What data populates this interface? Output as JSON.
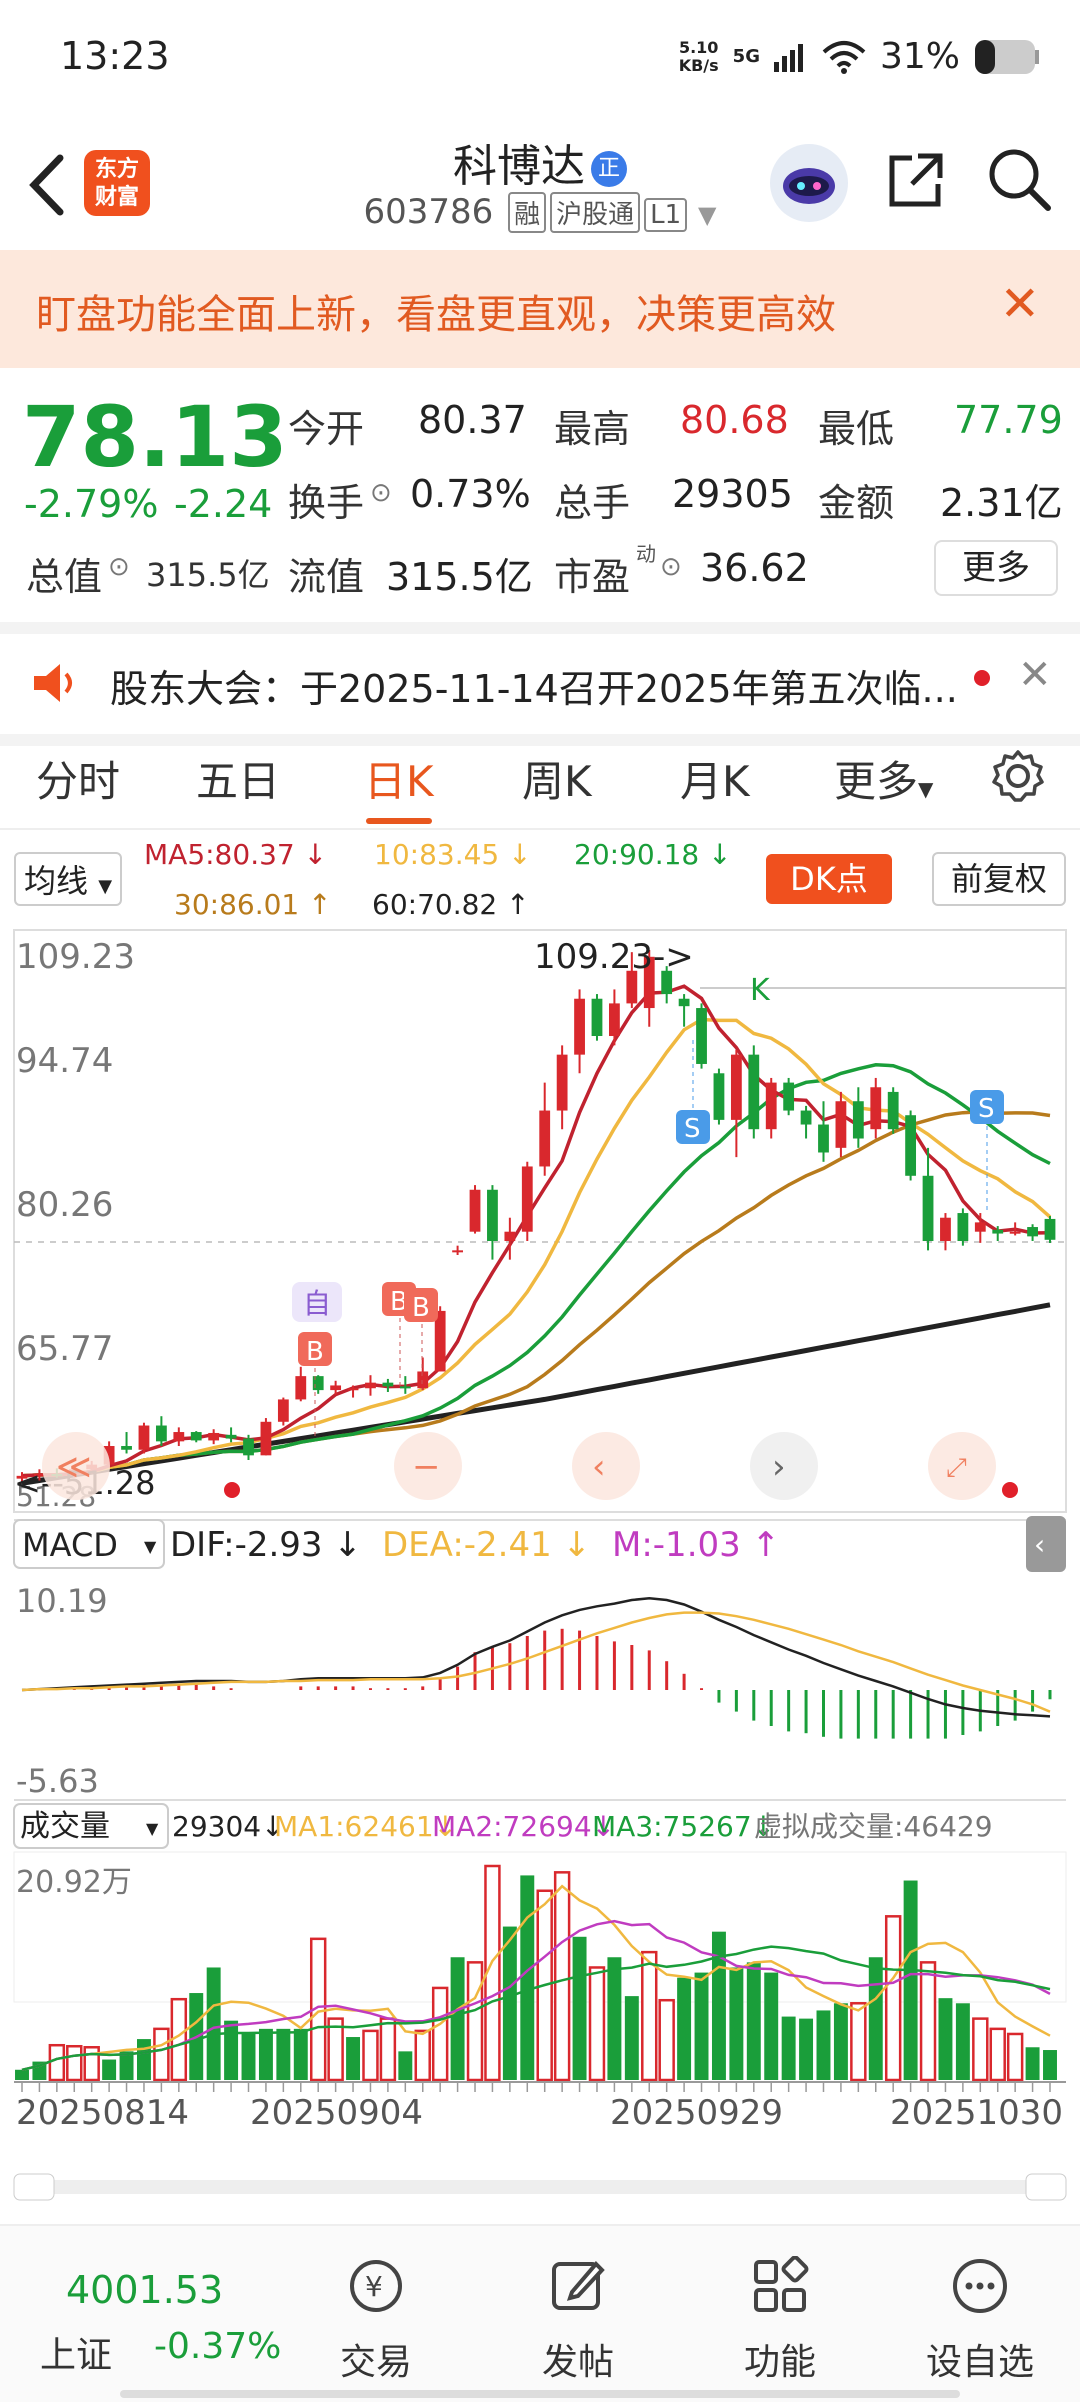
{
  "status_bar": {
    "time": "13:23",
    "net_speed": "5.10\nKB/s",
    "signal": "5G",
    "battery": "31%"
  },
  "header": {
    "title": "科博达",
    "badge": "正",
    "code": "603786",
    "tags": [
      "融",
      "沪股通",
      "L1"
    ],
    "logo_text": "东方财富"
  },
  "banner": {
    "text": "盯盘功能全面上新，看盘更直观，决策更高效",
    "close": "✕"
  },
  "quote": {
    "price": "78.13",
    "change_pct": "-2.79%",
    "change": "-2.24",
    "fields": {
      "open_label": "今开",
      "open": "80.37",
      "high_label": "最高",
      "high": "80.68",
      "low_label": "最低",
      "low": "77.79",
      "turnover_label": "换手",
      "turnover": "0.73%",
      "volume_label": "总手",
      "volume": "29305",
      "amount_label": "金额",
      "amount": "2.31亿",
      "mktcap_label": "总值",
      "mktcap": "315.5亿",
      "float_label": "流值",
      "float": "315.5亿",
      "pe_label": "市盈",
      "pe_sup": "动",
      "pe": "36.62"
    },
    "more": "更多"
  },
  "notice": {
    "text": "股东大会：于2025-11-14召开2025年第五次临..."
  },
  "tabs": [
    "分时",
    "五日",
    "日K",
    "周K",
    "月K",
    "更多"
  ],
  "active_tab": "日K",
  "ma_row": {
    "selector": "均线",
    "ma5": "MA5:80.37 ↓",
    "ma10": "10:83.45 ↓",
    "ma20": "20:90.18 ↓",
    "ma30": "30:86.01 ↑",
    "ma60": "60:70.82 ↑",
    "dk": "DK点",
    "adjust": "前复权"
  },
  "kline": {
    "y_labels": [
      "109.23",
      "94.74",
      "80.26",
      "65.77",
      "51.28"
    ],
    "peak_label": "109.23->",
    "low_label": "<--51.28",
    "markers": [
      "自",
      "B",
      "B",
      "B",
      "S",
      "S",
      "K"
    ],
    "colors": {
      "up": "#d9282d",
      "down": "#1a9e3a",
      "ma5": "#c0222f",
      "ma10": "#f0b840",
      "ma20": "#1a9e3a",
      "ma30": "#b87b1c",
      "ma60": "#222222"
    }
  },
  "macd": {
    "selector": "MACD",
    "dif": "DIF:-2.93 ↓",
    "dea": "DEA:-2.41 ↓",
    "m": "M:-1.03 ↑",
    "y_top": "10.19",
    "y_bottom": "-5.63"
  },
  "volume": {
    "selector": "成交量",
    "vol": "29304↓",
    "ma1": "MA1:62461↓",
    "ma2": "MA2:72694↓",
    "ma3": "MA3:75267↓",
    "virtual": "虚拟成交量:46429",
    "y_top": "20.92万"
  },
  "x_dates": [
    "20250814",
    "20250904",
    "20250929",
    "20251030"
  ],
  "bottom_nav": {
    "index_value": "4001.53",
    "index_name": "上证",
    "index_change": "-0.37%",
    "items": [
      "交易",
      "发帖",
      "功能",
      "设自选"
    ]
  },
  "chart_data": {
    "type": "candlestick",
    "title": "",
    "x_range": [
      "20250814",
      "20251030"
    ],
    "y_range": [
      51.28,
      109.23
    ],
    "ohlc": [
      [
        52.5,
        53.2,
        52.0,
        52.8
      ],
      [
        52.8,
        53.5,
        52.3,
        53.0
      ],
      [
        53.0,
        53.6,
        52.6,
        52.9
      ],
      [
        53.0,
        53.8,
        52.6,
        53.5
      ],
      [
        53.5,
        54.4,
        53.0,
        54.0
      ],
      [
        54.0,
        56.5,
        53.8,
        56.0
      ],
      [
        56.0,
        57.5,
        55.2,
        55.6
      ],
      [
        55.6,
        58.5,
        55.2,
        58.2
      ],
      [
        58.2,
        59.2,
        56.0,
        56.5
      ],
      [
        56.5,
        58.0,
        56.0,
        57.5
      ],
      [
        57.5,
        57.6,
        56.4,
        56.6
      ],
      [
        56.6,
        57.8,
        56.2,
        57.4
      ],
      [
        57.2,
        58.0,
        56.4,
        56.8
      ],
      [
        56.8,
        57.2,
        54.5,
        55.0
      ],
      [
        55.0,
        59.0,
        55.0,
        58.6
      ],
      [
        58.6,
        61.2,
        58.2,
        61.0
      ],
      [
        61.0,
        64.5,
        60.8,
        63.5
      ],
      [
        63.5,
        63.6,
        61.6,
        62.0
      ],
      [
        62.0,
        63.0,
        61.5,
        62.5
      ],
      [
        62.0,
        62.5,
        61.2,
        62.2
      ],
      [
        62.2,
        63.6,
        61.4,
        62.8
      ],
      [
        62.8,
        63.2,
        61.8,
        62.4
      ],
      [
        62.4,
        63.5,
        61.6,
        62.2
      ],
      [
        62.2,
        65.5,
        62.0,
        64.0
      ],
      [
        64.0,
        71.0,
        64.0,
        70.5
      ],
      [
        77.0,
        77.5,
        76.5,
        77.0
      ],
      [
        79.0,
        84.0,
        78.8,
        83.5
      ],
      [
        83.5,
        84.0,
        76.0,
        78.0
      ],
      [
        78.0,
        80.5,
        76.0,
        79.0
      ],
      [
        79.0,
        86.5,
        78.0,
        86.0
      ],
      [
        86.0,
        95.0,
        85.0,
        92.0
      ],
      [
        92.0,
        99.0,
        90.0,
        98.0
      ],
      [
        98.0,
        105.0,
        96.0,
        104.0
      ],
      [
        104.0,
        104.5,
        99.5,
        100.0
      ],
      [
        100.0,
        105.0,
        99.0,
        103.5
      ],
      [
        103.5,
        109.0,
        103.0,
        107.0
      ],
      [
        103.0,
        109.23,
        101.0,
        108.5
      ],
      [
        107.0,
        107.5,
        103.5,
        104.5
      ],
      [
        104.0,
        104.5,
        101.0,
        103.2
      ],
      [
        103.0,
        103.5,
        96.5,
        97.0
      ],
      [
        96.0,
        96.5,
        90.5,
        91.0
      ],
      [
        91.0,
        98.5,
        87.0,
        98.0
      ],
      [
        98.0,
        99.0,
        89.0,
        90.0
      ],
      [
        90.0,
        95.5,
        89.0,
        95.0
      ],
      [
        95.0,
        95.5,
        91.5,
        92.0
      ],
      [
        92.0,
        92.5,
        89.0,
        90.5
      ],
      [
        90.5,
        93.0,
        86.5,
        87.5
      ],
      [
        88.0,
        94.0,
        87.0,
        93.0
      ],
      [
        93.0,
        94.5,
        88.0,
        89.0
      ],
      [
        90.0,
        95.5,
        89.0,
        94.5
      ],
      [
        94.0,
        94.5,
        89.5,
        90.0
      ],
      [
        91.5,
        92.0,
        84.5,
        85.0
      ],
      [
        85.0,
        88.0,
        77.0,
        78.0
      ],
      [
        78.0,
        81.0,
        77.0,
        80.5
      ],
      [
        81.0,
        81.5,
        77.5,
        78.0
      ],
      [
        79.0,
        81.0,
        77.8,
        80.0
      ],
      [
        79.2,
        79.6,
        78.0,
        78.8
      ],
      [
        79.0,
        80.0,
        78.6,
        79.0
      ],
      [
        79.5,
        79.8,
        78.0,
        78.5
      ],
      [
        80.37,
        80.68,
        77.79,
        78.13
      ]
    ],
    "macd": {
      "dif": [
        0.0,
        0.1,
        0.2,
        0.3,
        0.4,
        0.5,
        0.6,
        0.7,
        0.8,
        0.9,
        1.0,
        1.0,
        1.0,
        0.9,
        0.9,
        1.0,
        1.2,
        1.3,
        1.3,
        1.3,
        1.3,
        1.3,
        1.3,
        1.4,
        1.9,
        2.8,
        4.0,
        4.8,
        5.5,
        6.5,
        7.5,
        8.3,
        8.9,
        9.3,
        9.6,
        10.0,
        10.19,
        10.0,
        9.5,
        8.7,
        7.8,
        7.0,
        6.1,
        5.3,
        4.5,
        3.8,
        3.0,
        2.3,
        1.6,
        1.0,
        0.4,
        -0.3,
        -1.0,
        -1.6,
        -2.0,
        -2.3,
        -2.5,
        -2.7,
        -2.8,
        -2.93
      ],
      "dea": [
        0.0,
        0.1,
        0.1,
        0.2,
        0.2,
        0.3,
        0.4,
        0.4,
        0.5,
        0.6,
        0.7,
        0.8,
        0.9,
        0.9,
        0.9,
        1.0,
        1.0,
        1.1,
        1.1,
        1.1,
        1.2,
        1.2,
        1.2,
        1.2,
        1.3,
        1.5,
        1.9,
        2.4,
        2.9,
        3.5,
        4.2,
        4.9,
        5.6,
        6.3,
        6.9,
        7.5,
        8.0,
        8.4,
        8.6,
        8.6,
        8.5,
        8.2,
        7.8,
        7.3,
        6.8,
        6.2,
        5.6,
        5.0,
        4.3,
        3.7,
        3.1,
        2.4,
        1.7,
        1.1,
        0.5,
        0.0,
        -0.5,
        -1.0,
        -1.6,
        -2.41
      ],
      "m": [
        0.0,
        0.0,
        0.2,
        0.2,
        0.4,
        0.4,
        0.4,
        0.6,
        0.6,
        0.6,
        0.6,
        0.4,
        0.2,
        0.0,
        0.0,
        0.0,
        0.4,
        0.4,
        0.4,
        0.4,
        0.2,
        0.2,
        0.2,
        0.4,
        1.2,
        2.6,
        4.2,
        4.8,
        5.2,
        6.0,
        6.6,
        6.8,
        6.6,
        6.0,
        5.4,
        5.0,
        4.4,
        3.2,
        1.8,
        0.2,
        -1.4,
        -2.4,
        -3.4,
        -4.0,
        -4.6,
        -4.8,
        -5.2,
        -5.4,
        -5.4,
        -5.4,
        -5.4,
        -5.4,
        -5.4,
        -5.4,
        -5.0,
        -4.6,
        -4.0,
        -3.4,
        -2.4,
        -1.03
      ]
    },
    "volume": [
      [
        1.0,
        0
      ],
      [
        1.8,
        0
      ],
      [
        3.4,
        1
      ],
      [
        3.3,
        1
      ],
      [
        3.2,
        1
      ],
      [
        2.0,
        0
      ],
      [
        2.8,
        0
      ],
      [
        4.0,
        0
      ],
      [
        5.0,
        1
      ],
      [
        7.9,
        1
      ],
      [
        8.5,
        0
      ],
      [
        11.0,
        0
      ],
      [
        5.8,
        0
      ],
      [
        4.6,
        0
      ],
      [
        5.0,
        0
      ],
      [
        5.0,
        0
      ],
      [
        5.0,
        0
      ],
      [
        13.8,
        1
      ],
      [
        6.0,
        1
      ],
      [
        4.2,
        0
      ],
      [
        4.8,
        1
      ],
      [
        6.0,
        1
      ],
      [
        2.8,
        0
      ],
      [
        4.8,
        1
      ],
      [
        9.0,
        1
      ],
      [
        12.0,
        0
      ],
      [
        11.5,
        1
      ],
      [
        20.92,
        1
      ],
      [
        15.0,
        0
      ],
      [
        20.0,
        0
      ],
      [
        18.5,
        1
      ],
      [
        20.3,
        1
      ],
      [
        14.0,
        0
      ],
      [
        11.0,
        1
      ],
      [
        12.0,
        0
      ],
      [
        8.2,
        0
      ],
      [
        12.5,
        1
      ],
      [
        7.8,
        1
      ],
      [
        10.0,
        0
      ],
      [
        10.5,
        0
      ],
      [
        14.5,
        0
      ],
      [
        11.0,
        0
      ],
      [
        11.5,
        0
      ],
      [
        10.5,
        0
      ],
      [
        6.2,
        0
      ],
      [
        6.0,
        0
      ],
      [
        6.8,
        0
      ],
      [
        7.5,
        0
      ],
      [
        7.5,
        1
      ],
      [
        12.0,
        0
      ],
      [
        16.0,
        1
      ],
      [
        19.5,
        0
      ],
      [
        11.5,
        1
      ],
      [
        8.0,
        0
      ],
      [
        7.5,
        0
      ],
      [
        6.0,
        1
      ],
      [
        5.0,
        1
      ],
      [
        4.5,
        1
      ],
      [
        3.2,
        0
      ],
      [
        2.93,
        0
      ]
    ]
  }
}
